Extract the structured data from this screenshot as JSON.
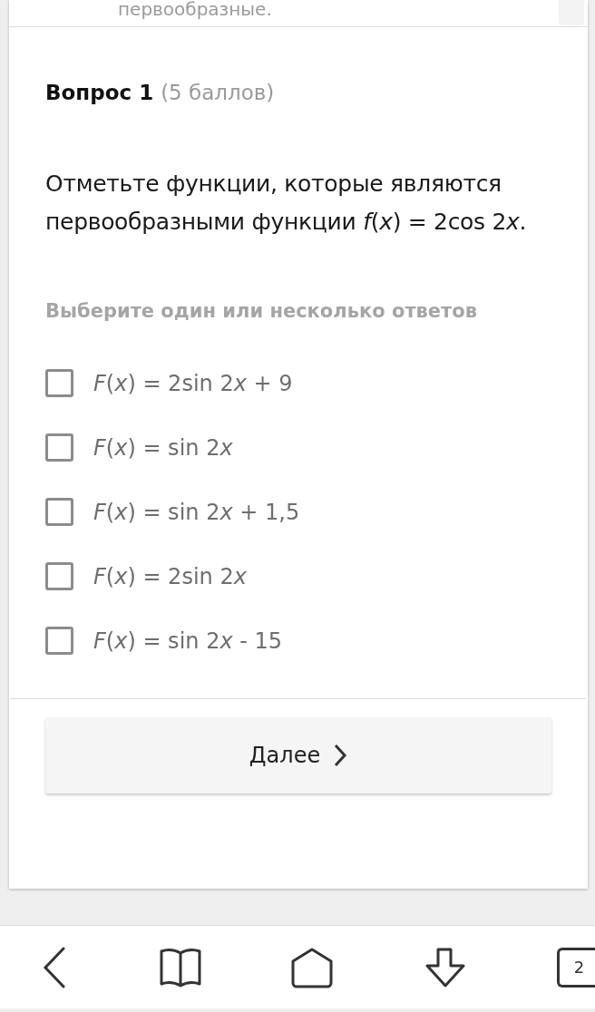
{
  "previous_text": "первообразные.",
  "question": {
    "title": "Вопрос 1",
    "points": "(5 баллов)",
    "text": [
      {
        "text": "Отметьте функции, которые являются первообразными функции ",
        "italic": false
      },
      {
        "text": "f",
        "italic": true
      },
      {
        "text": "(",
        "italic": false
      },
      {
        "text": "x",
        "italic": true
      },
      {
        "text": ") = 2cos 2",
        "italic": false
      },
      {
        "text": "x",
        "italic": true
      },
      {
        "text": ".",
        "italic": false
      }
    ],
    "hint": "Выберите один или несколько ответов",
    "options": [
      {
        "label": [
          {
            "text": "F",
            "italic": true
          },
          {
            "text": "(",
            "italic": false
          },
          {
            "text": "x",
            "italic": true
          },
          {
            "text": ") = 2sin 2",
            "italic": false
          },
          {
            "text": "x",
            "italic": true
          },
          {
            "text": " + 9",
            "italic": false
          }
        ],
        "checked": false
      },
      {
        "label": [
          {
            "text": "F",
            "italic": true
          },
          {
            "text": "(",
            "italic": false
          },
          {
            "text": "x",
            "italic": true
          },
          {
            "text": ") = sin 2",
            "italic": false
          },
          {
            "text": "x",
            "italic": true
          }
        ],
        "checked": false
      },
      {
        "label": [
          {
            "text": "F",
            "italic": true
          },
          {
            "text": "(",
            "italic": false
          },
          {
            "text": "x",
            "italic": true
          },
          {
            "text": ") = sin 2",
            "italic": false
          },
          {
            "text": "x",
            "italic": true
          },
          {
            "text": " + 1,5",
            "italic": false
          }
        ],
        "checked": false
      },
      {
        "label": [
          {
            "text": "F",
            "italic": true
          },
          {
            "text": "(",
            "italic": false
          },
          {
            "text": "x",
            "italic": true
          },
          {
            "text": ") = 2sin 2",
            "italic": false
          },
          {
            "text": "x",
            "italic": true
          }
        ],
        "checked": false
      },
      {
        "label": [
          {
            "text": "F",
            "italic": true
          },
          {
            "text": "(",
            "italic": false
          },
          {
            "text": "x",
            "italic": true
          },
          {
            "text": ") = sin 2",
            "italic": false
          },
          {
            "text": "x",
            "italic": true
          },
          {
            "text": " - 15",
            "italic": false
          }
        ],
        "checked": false
      }
    ]
  },
  "next_button": "Далее",
  "toolbar": {
    "tab_count": "2"
  }
}
